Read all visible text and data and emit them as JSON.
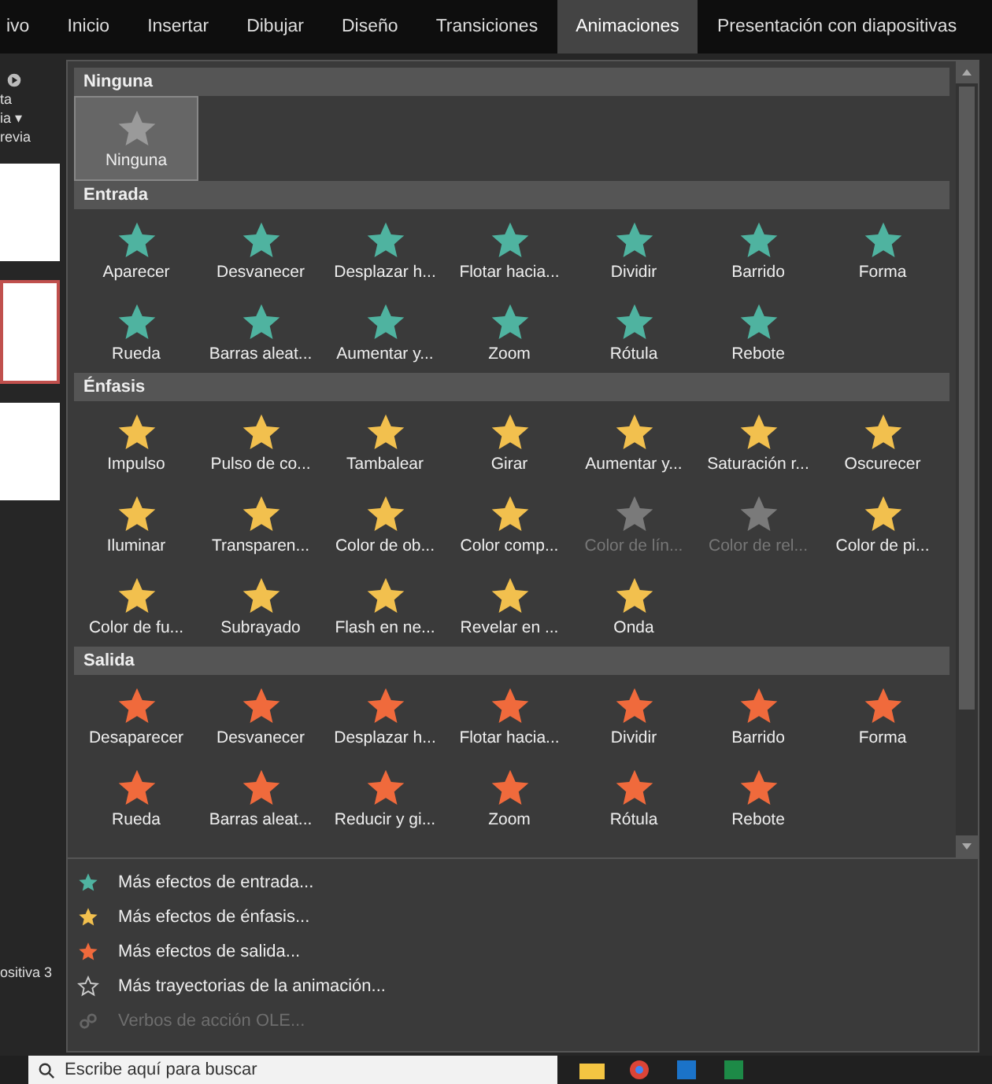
{
  "tabs": [
    {
      "label": "ivo",
      "selected": false
    },
    {
      "label": "Inicio",
      "selected": false
    },
    {
      "label": "Insertar",
      "selected": false
    },
    {
      "label": "Dibujar",
      "selected": false
    },
    {
      "label": "Diseño",
      "selected": false
    },
    {
      "label": "Transiciones",
      "selected": false
    },
    {
      "label": "Animaciones",
      "selected": true
    },
    {
      "label": "Presentación con diapositivas",
      "selected": false
    }
  ],
  "ribbon_fragments": [
    "ta",
    "ia ▾",
    "revia"
  ],
  "status_fragment": "ositiva 3",
  "gallery": {
    "sections": [
      {
        "title": "Ninguna",
        "kind": "ninguna",
        "items": [
          {
            "label": "Ninguna",
            "selected": true,
            "disabled": false
          }
        ]
      },
      {
        "title": "Entrada",
        "kind": "entrada",
        "items": [
          {
            "label": "Aparecer",
            "selected": false,
            "disabled": false
          },
          {
            "label": "Desvanecer",
            "selected": false,
            "disabled": false
          },
          {
            "label": "Desplazar h...",
            "selected": false,
            "disabled": false
          },
          {
            "label": "Flotar hacia...",
            "selected": false,
            "disabled": false
          },
          {
            "label": "Dividir",
            "selected": false,
            "disabled": false
          },
          {
            "label": "Barrido",
            "selected": false,
            "disabled": false
          },
          {
            "label": "Forma",
            "selected": false,
            "disabled": false
          },
          {
            "label": "Rueda",
            "selected": false,
            "disabled": false
          },
          {
            "label": "Barras aleat...",
            "selected": false,
            "disabled": false
          },
          {
            "label": "Aumentar y...",
            "selected": false,
            "disabled": false
          },
          {
            "label": "Zoom",
            "selected": false,
            "disabled": false
          },
          {
            "label": "Rótula",
            "selected": false,
            "disabled": false
          },
          {
            "label": "Rebote",
            "selected": false,
            "disabled": false
          }
        ]
      },
      {
        "title": "Énfasis",
        "kind": "enfasis",
        "items": [
          {
            "label": "Impulso",
            "selected": false,
            "disabled": false
          },
          {
            "label": "Pulso de co...",
            "selected": false,
            "disabled": false
          },
          {
            "label": "Tambalear",
            "selected": false,
            "disabled": false
          },
          {
            "label": "Girar",
            "selected": false,
            "disabled": false
          },
          {
            "label": "Aumentar y...",
            "selected": false,
            "disabled": false
          },
          {
            "label": "Saturación r...",
            "selected": false,
            "disabled": false
          },
          {
            "label": "Oscurecer",
            "selected": false,
            "disabled": false
          },
          {
            "label": "Iluminar",
            "selected": false,
            "disabled": false
          },
          {
            "label": "Transparen...",
            "selected": false,
            "disabled": false
          },
          {
            "label": "Color de ob...",
            "selected": false,
            "disabled": false
          },
          {
            "label": "Color comp...",
            "selected": false,
            "disabled": false
          },
          {
            "label": "Color de lín...",
            "selected": false,
            "disabled": true
          },
          {
            "label": "Color de rel...",
            "selected": false,
            "disabled": true
          },
          {
            "label": "Color de pi...",
            "selected": false,
            "disabled": false
          },
          {
            "label": "Color de fu...",
            "selected": false,
            "disabled": false
          },
          {
            "label": "Subrayado",
            "selected": false,
            "disabled": false
          },
          {
            "label": "Flash en ne...",
            "selected": false,
            "disabled": false
          },
          {
            "label": "Revelar en ...",
            "selected": false,
            "disabled": false
          },
          {
            "label": "Onda",
            "selected": false,
            "disabled": false
          }
        ]
      },
      {
        "title": "Salida",
        "kind": "salida",
        "items": [
          {
            "label": "Desaparecer",
            "selected": false,
            "disabled": false
          },
          {
            "label": "Desvanecer",
            "selected": false,
            "disabled": false
          },
          {
            "label": "Desplazar h...",
            "selected": false,
            "disabled": false
          },
          {
            "label": "Flotar hacia...",
            "selected": false,
            "disabled": false
          },
          {
            "label": "Dividir",
            "selected": false,
            "disabled": false
          },
          {
            "label": "Barrido",
            "selected": false,
            "disabled": false
          },
          {
            "label": "Forma",
            "selected": false,
            "disabled": false
          },
          {
            "label": "Rueda",
            "selected": false,
            "disabled": false
          },
          {
            "label": "Barras aleat...",
            "selected": false,
            "disabled": false
          },
          {
            "label": "Reducir y gi...",
            "selected": false,
            "disabled": false
          },
          {
            "label": "Zoom",
            "selected": false,
            "disabled": false
          },
          {
            "label": "Rótula",
            "selected": false,
            "disabled": false
          },
          {
            "label": "Rebote",
            "selected": false,
            "disabled": false
          }
        ]
      }
    ]
  },
  "more": [
    {
      "label": "Más efectos de entrada...",
      "kind": "entrada",
      "disabled": false
    },
    {
      "label": "Más efectos de énfasis...",
      "kind": "enfasis",
      "disabled": false
    },
    {
      "label": "Más efectos de salida...",
      "kind": "salida",
      "disabled": false
    },
    {
      "label": "Más trayectorias de la animación...",
      "kind": "path",
      "disabled": false
    },
    {
      "label": "Verbos de acción OLE...",
      "kind": "ole",
      "disabled": true
    }
  ],
  "taskbar": {
    "search_placeholder": "Escribe aquí para buscar"
  }
}
